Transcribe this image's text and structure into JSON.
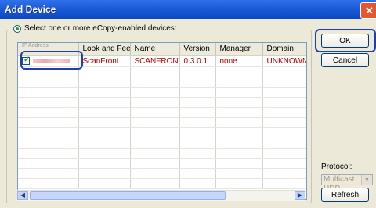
{
  "window": {
    "title": "Add Device",
    "close_glyph": "✕"
  },
  "device_list": {
    "instruction": "Select one or more eCopy-enabled devices:",
    "columns": [
      "IP Address",
      "Look and Feel",
      "Name",
      "Version",
      "Manager",
      "Domain"
    ],
    "rows": [
      {
        "checked": true,
        "ip_address": "",
        "look_and_feel": "ScanFront",
        "name": "SCANFRONT...",
        "version": "0.3.0.1",
        "manager": "none",
        "domain": "UNKNOWN"
      }
    ]
  },
  "buttons": {
    "ok": "OK",
    "cancel": "Cancel",
    "refresh": "Refresh"
  },
  "protocol": {
    "label": "Protocol:",
    "value": "Multicast UDP"
  },
  "scrollbar": {
    "left_icon": "arrow-left-icon",
    "right_icon": "arrow-right-icon",
    "left_glyph": "◀",
    "right_glyph": "▶"
  },
  "combo_arrow_glyph": "▼",
  "colors": {
    "titlebar": "#0A48C6",
    "row_text": "#B00000",
    "highlight": "#1F3FAE"
  }
}
